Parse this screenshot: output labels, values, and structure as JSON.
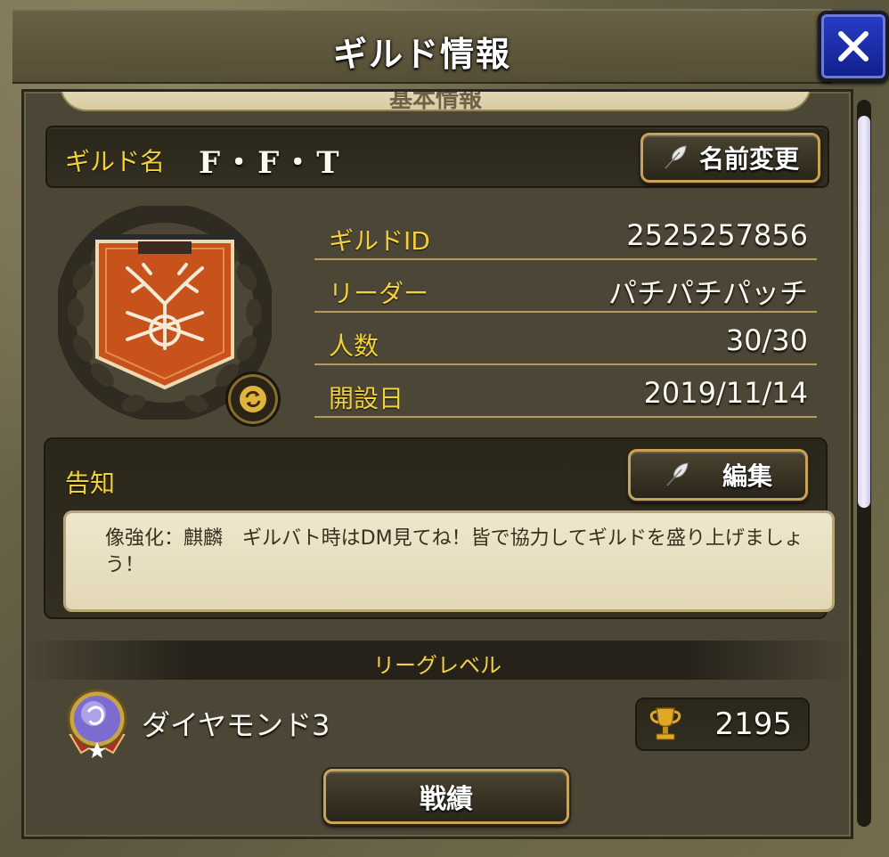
{
  "window": {
    "title": "ギルド情報",
    "close_label": "×"
  },
  "section": {
    "tab_label": "基本情報"
  },
  "guild": {
    "name_label": "ギルド名",
    "name": "F・F・T",
    "rename_button": "名前変更"
  },
  "info": [
    {
      "key": "ギルドID",
      "value": "2525257856"
    },
    {
      "key": "リーダー",
      "value": "パチパチパッチ"
    },
    {
      "key": "人数",
      "value": "30/30"
    },
    {
      "key": "開設日",
      "value": "2019/11/14"
    }
  ],
  "notice": {
    "label": "告知",
    "edit_button": "編集",
    "text": "像強化：麒麟　ギルバト時はDM見てね！皆で協力してギルドを盛り上げましょう！"
  },
  "league": {
    "header": "リーグレベル",
    "rank": "ダイヤモンド3",
    "trophies": "2195",
    "record_button": "戦績"
  },
  "colors": {
    "accent_gold": "#f2d13a",
    "banner_orange": "#c8521c",
    "close_blue": "#2a3cc8"
  }
}
